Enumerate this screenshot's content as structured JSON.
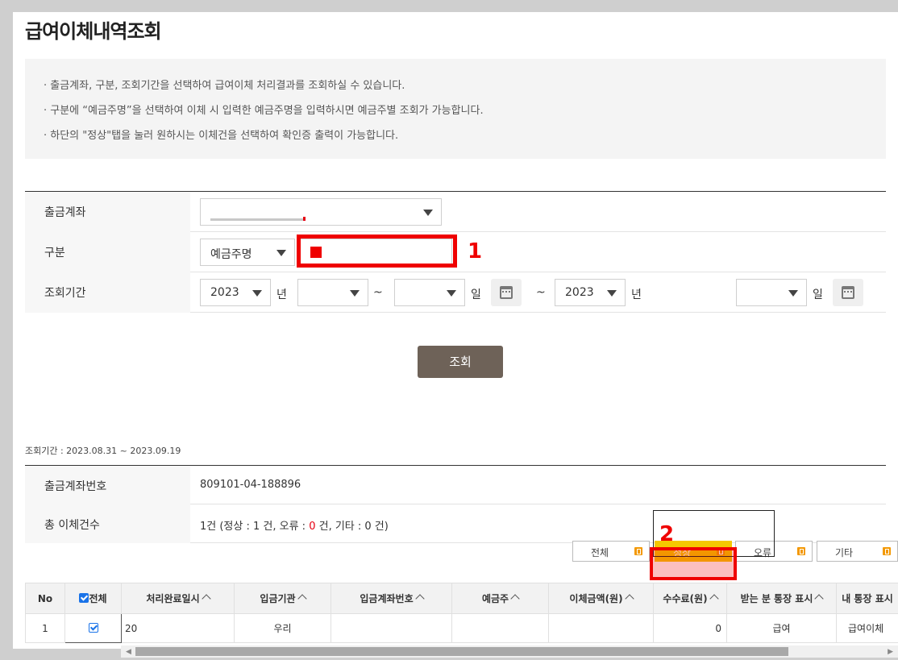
{
  "page_title": "급여이체내역조회",
  "info_lines": [
    "출금계좌, 구분, 조회기간을 선택하여 급여이체 처리결과를 조회하실 수 있습니다.",
    "구분에 “예금주명”을 선택하여 이체 시 입력한 예금주명을 입력하시면 예금주별 조회가 가능합니다.",
    "하단의 \"정상\"탭을 눌러 원하시는 이체건을 선택하여 확인증 출력이 가능합니다."
  ],
  "form": {
    "account_label": "출금계좌",
    "category_label": "구분",
    "category_value": "예금주명",
    "period_label": "조회기간",
    "start_year": "2023",
    "year_unit": "년",
    "day_unit": "일",
    "range_sep": "~",
    "wave_sep": "~",
    "end_year": "2023"
  },
  "search_button": "조회",
  "period_text": "조회기간 : 2023.08.31 ~ 2023.09.19",
  "summary": {
    "account_no_label": "출금계좌번호",
    "account_no": "809101-04-188896",
    "total_label": "총 이체건수",
    "total_prefix": "1건 (정상 : 1 건, 오류 : ",
    "error_count": "0",
    "total_suffix": " 건, 기타 : 0 건)"
  },
  "tabs": [
    "전체",
    "정상",
    "오류",
    "기타"
  ],
  "table": {
    "headers": [
      "No",
      "전체",
      "처리완료일시",
      "입금기관",
      "입금계좌번호",
      "예금주",
      "이체금액(원)",
      "수수료(원)",
      "받는 분 통장 표시",
      "내 통장 표시"
    ],
    "rows": [
      [
        "1",
        "",
        "20",
        "우리",
        "",
        "",
        "",
        "0",
        "급여",
        "급여이체"
      ]
    ]
  },
  "markers": [
    "1",
    "2"
  ],
  "colors": {
    "accent_button": "#6e6258",
    "active_tab": "#f5c800",
    "annotation": "#ef0000",
    "badge": "#f39800"
  }
}
